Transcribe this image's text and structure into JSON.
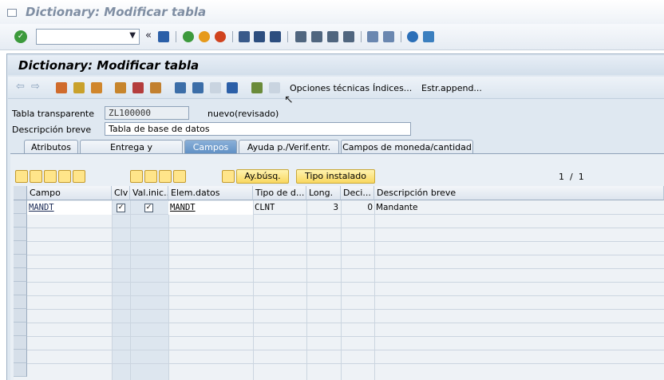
{
  "window": {
    "title": "Dictionary: Modificar tabla"
  },
  "screen": {
    "title": "Dictionary: Modificar tabla"
  },
  "app_toolbar": {
    "technical_options": "Opciones técnicas",
    "indexes": "Índices...",
    "append_structure": "Estr.append..."
  },
  "header": {
    "table_label": "Tabla transparente",
    "table_value": "ZL100000",
    "table_status": "nuevo(revisado)",
    "desc_label": "Descripción breve",
    "desc_value": "Tabla de base de datos"
  },
  "tabs": [
    {
      "label": "Atributos"
    },
    {
      "label": "Entrega y actualización"
    },
    {
      "label": "Campos"
    },
    {
      "label": "Ayuda p./Verif.entr."
    },
    {
      "label": "Campos de moneda/cantidad"
    }
  ],
  "fields_toolbar": {
    "search_help": "Ay.búsq.",
    "builtin_type": "Tipo instalado",
    "page": "1  /  1"
  },
  "grid": {
    "headers": [
      "Campo",
      "Clv",
      "Val.inic...",
      "Elem.datos",
      "Tipo de d...",
      "Long.",
      "Deci...",
      "Descripción breve"
    ],
    "rows": [
      {
        "campo": "MANDT",
        "key": true,
        "initial": true,
        "element": "MANDT",
        "type": "CLNT",
        "length": "3",
        "decimals": "0",
        "description": "Mandante"
      }
    ]
  }
}
